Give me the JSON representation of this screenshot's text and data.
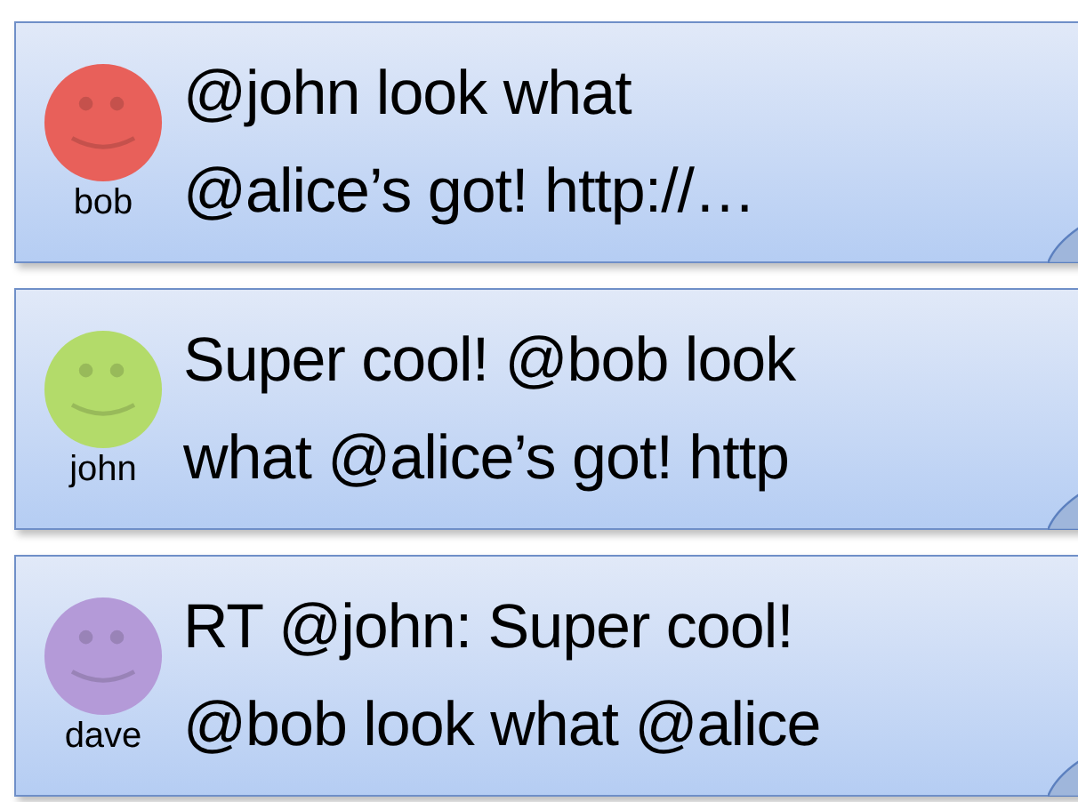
{
  "tweets": [
    {
      "user": "bob",
      "color": "#e8605a",
      "lines": [
        "@john look what",
        "@alice’s got! http://…"
      ]
    },
    {
      "user": "john",
      "color": "#b3db6a",
      "lines": [
        "Super cool! @bob look",
        "what @alice’s got! http"
      ]
    },
    {
      "user": "dave",
      "color": "#b49ad8",
      "lines": [
        "RT @john: Super cool!",
        "@bob look what @alice"
      ]
    }
  ]
}
